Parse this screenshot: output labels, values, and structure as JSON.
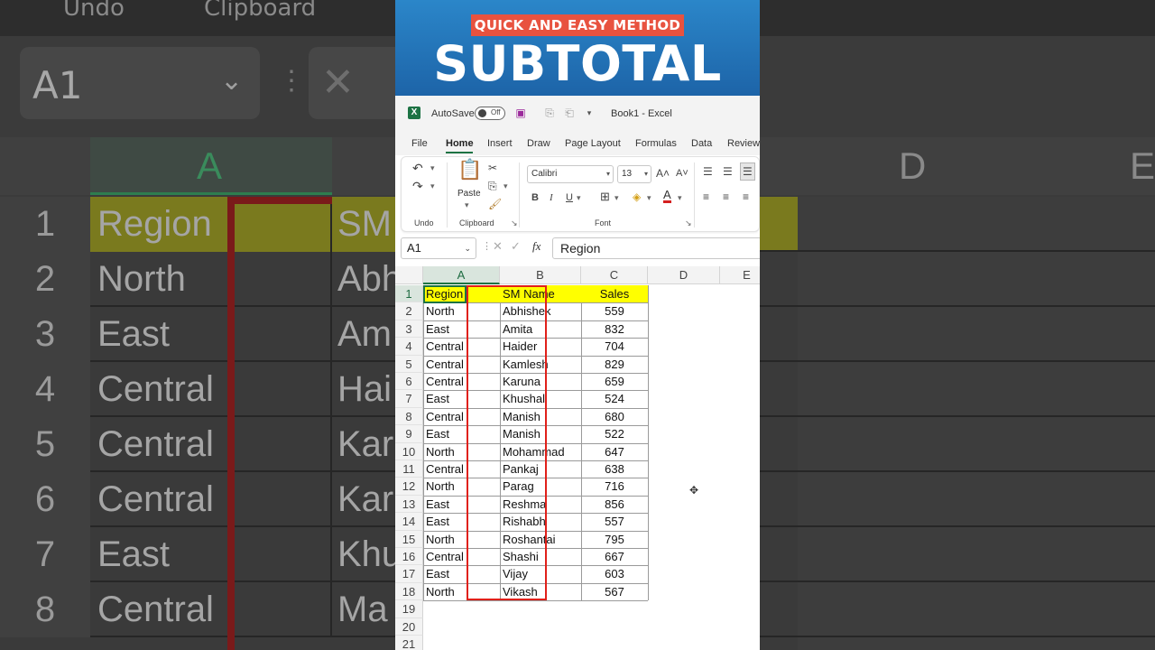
{
  "banner": {
    "tag": "QUICK AND EASY METHOD",
    "title": "SUBTOTAL"
  },
  "titlebar": {
    "autosave_label": "AutoSave",
    "autosave_state": "Off",
    "book_title": "Book1  -  Excel"
  },
  "tabs": [
    "File",
    "Home",
    "Insert",
    "Draw",
    "Page Layout",
    "Formulas",
    "Data",
    "Review"
  ],
  "ribbon": {
    "undo_group": "Undo",
    "clipboard_group": "Clipboard",
    "font_group": "Font",
    "paste_label": "Paste",
    "font_name": "Calibri",
    "font_size": "13"
  },
  "formula_bar": {
    "name_box": "A1",
    "fx": "fx",
    "content": "Region"
  },
  "sheet": {
    "columns": [
      "A",
      "B",
      "C",
      "D",
      "E"
    ],
    "row_numbers": [
      "1",
      "2",
      "3",
      "4",
      "5",
      "6",
      "7",
      "8",
      "9",
      "10",
      "11",
      "12",
      "13",
      "14",
      "15",
      "16",
      "17",
      "18",
      "19",
      "20",
      "21"
    ],
    "headers": {
      "region": "Region",
      "sm_name": "SM Name",
      "sales": "Sales"
    },
    "rows": [
      {
        "region": "North",
        "name": "Abhishek",
        "sales": "559"
      },
      {
        "region": "East",
        "name": "Amita",
        "sales": "832"
      },
      {
        "region": "Central",
        "name": "Haider",
        "sales": "704"
      },
      {
        "region": "Central",
        "name": "Kamlesh",
        "sales": "829"
      },
      {
        "region": "Central",
        "name": "Karuna",
        "sales": "659"
      },
      {
        "region": "East",
        "name": "Khushal",
        "sales": "524"
      },
      {
        "region": "Central",
        "name": "Manish",
        "sales": "680"
      },
      {
        "region": "East",
        "name": "Manish",
        "sales": "522"
      },
      {
        "region": "North",
        "name": "Mohammad",
        "sales": "647"
      },
      {
        "region": "Central",
        "name": "Pankaj",
        "sales": "638"
      },
      {
        "region": "North",
        "name": "Parag",
        "sales": "716"
      },
      {
        "region": "East",
        "name": "Reshma",
        "sales": "856"
      },
      {
        "region": "East",
        "name": "Rishabh",
        "sales": "557"
      },
      {
        "region": "North",
        "name": "Roshantai",
        "sales": "795"
      },
      {
        "region": "Central",
        "name": "Shashi",
        "sales": "667"
      },
      {
        "region": "East",
        "name": "Vijay",
        "sales": "603"
      },
      {
        "region": "North",
        "name": "Vikash",
        "sales": "567"
      }
    ]
  },
  "background": {
    "top_labels": [
      "Undo",
      "Clipboard"
    ],
    "name_box": "A1",
    "col_labels": [
      "A",
      "D",
      "E"
    ],
    "row_numbers": [
      "1",
      "2",
      "3",
      "4",
      "5",
      "6",
      "7",
      "8"
    ],
    "col_a": [
      "Region",
      "North",
      "East",
      "Central",
      "Central",
      "Central",
      "East",
      "Central"
    ],
    "col_b": [
      "SM",
      "Abh",
      "Am",
      "Hai",
      "Kar",
      "Kar",
      "Khu",
      "Ma"
    ]
  },
  "colors": {
    "excel_green": "#1d7344",
    "highlight_yellow": "#ffff00",
    "outline_red": "#e0201a",
    "banner_blue": "#1f6fb2",
    "tag_red": "#e8523f"
  }
}
